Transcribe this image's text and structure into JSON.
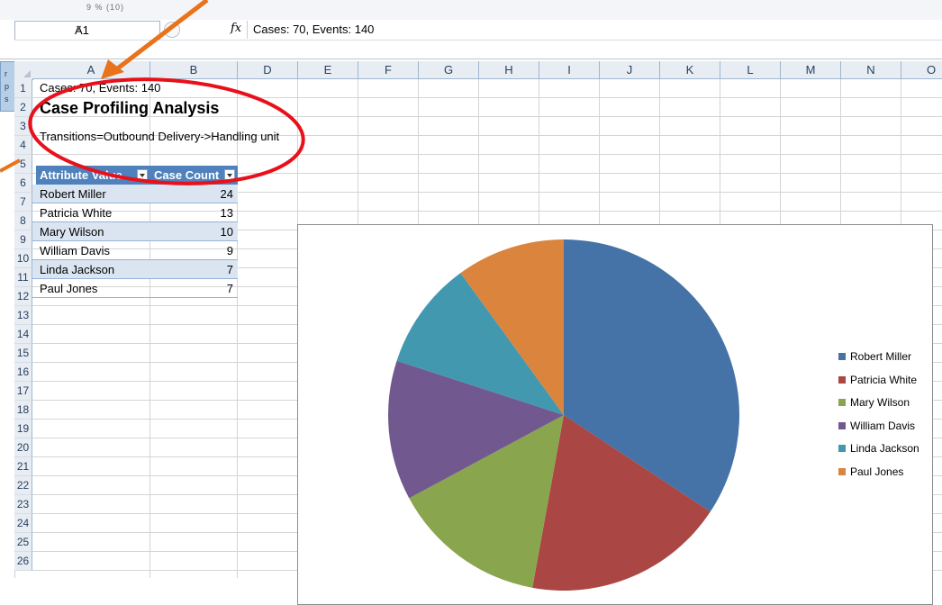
{
  "toolbar": {
    "faint_text": "9 % (10)"
  },
  "formula_bar": {
    "name_box": "A1",
    "fx_label": "fx",
    "content": "Cases: 70, Events: 140"
  },
  "columns": [
    "A",
    "B",
    "D",
    "E",
    "F",
    "G",
    "H",
    "I",
    "J",
    "K",
    "L",
    "M",
    "N",
    "O"
  ],
  "rows": [
    "1",
    "2",
    "3",
    "4",
    "5",
    "6",
    "7",
    "8",
    "9",
    "10",
    "11",
    "12",
    "13",
    "14",
    "15",
    "16",
    "17",
    "18",
    "19",
    "20",
    "21",
    "22",
    "23",
    "24",
    "25",
    "26"
  ],
  "sheet": {
    "a1": "Cases: 70, Events: 140",
    "title": "Case Profiling Analysis",
    "transitions": "Transitions=Outbound Delivery->Handling unit"
  },
  "table": {
    "headers": [
      "Attribute Value",
      "Case Count"
    ],
    "rows": [
      {
        "name": "Robert Miller",
        "count": "24"
      },
      {
        "name": "Patricia White",
        "count": "13"
      },
      {
        "name": "Mary Wilson",
        "count": "10"
      },
      {
        "name": "William Davis",
        "count": "9"
      },
      {
        "name": "Linda Jackson",
        "count": "7"
      },
      {
        "name": "Paul Jones",
        "count": "7"
      }
    ]
  },
  "colors": {
    "header_blue": "#4f81bd",
    "band_blue": "#dbe5f1",
    "annotation_red": "#e8101a",
    "annotation_orange": "#e8731a"
  },
  "chart_data": {
    "type": "pie",
    "categories": [
      "Robert Miller",
      "Patricia White",
      "Mary Wilson",
      "William Davis",
      "Linda Jackson",
      "Paul Jones"
    ],
    "values": [
      24,
      13,
      10,
      9,
      7,
      7
    ],
    "colors": [
      "#4572a7",
      "#aa4643",
      "#89a54e",
      "#71588f",
      "#4198af",
      "#db843d"
    ],
    "legend": "right"
  }
}
